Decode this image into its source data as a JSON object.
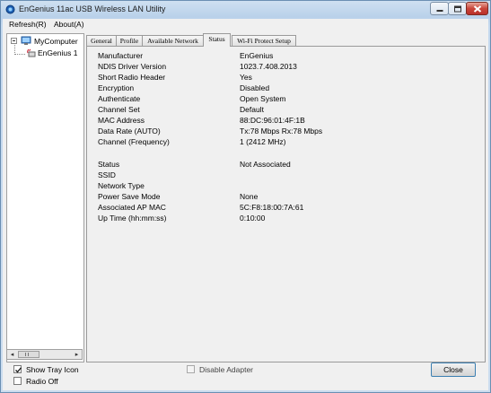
{
  "window": {
    "title": "EnGenius 11ac USB Wireless LAN Utility",
    "buttons": {
      "minimize_icon": "minimize-icon",
      "maximize_icon": "maximize-icon",
      "close_icon": "close-icon"
    }
  },
  "menu": {
    "items": [
      {
        "label": "Refresh(R)"
      },
      {
        "label": "About(A)"
      }
    ]
  },
  "tree": {
    "root_label": "MyComputer",
    "child_label": "EnGenius 1",
    "scroll_left": "◂",
    "scroll_right": "▸"
  },
  "tabs": [
    {
      "label": "General"
    },
    {
      "label": "Profile"
    },
    {
      "label": "Available Network"
    },
    {
      "label": "Status",
      "active": true
    },
    {
      "label": "Wi-Fi Protect Setup"
    }
  ],
  "status": {
    "group1": [
      {
        "label": "Manufacturer",
        "value": "EnGenius"
      },
      {
        "label": "NDIS Driver Version",
        "value": "1023.7.408.2013"
      },
      {
        "label": "Short Radio Header",
        "value": "Yes"
      },
      {
        "label": "Encryption",
        "value": "Disabled"
      },
      {
        "label": "Authenticate",
        "value": "Open System"
      },
      {
        "label": "Channel Set",
        "value": "Default"
      },
      {
        "label": "MAC Address",
        "value": "88:DC:96:01:4F:1B"
      },
      {
        "label": "Data Rate (AUTO)",
        "value": "Tx:78 Mbps Rx:78 Mbps"
      },
      {
        "label": "Channel (Frequency)",
        "value": "1 (2412 MHz)"
      }
    ],
    "group2": [
      {
        "label": "Status",
        "value": "Not Associated"
      },
      {
        "label": "SSID",
        "value": ""
      },
      {
        "label": "Network Type",
        "value": ""
      },
      {
        "label": "Power Save Mode",
        "value": "None"
      },
      {
        "label": "Associated AP MAC",
        "value": "5C:F8:18:00:7A:61"
      },
      {
        "label": "Up Time (hh:mm:ss)",
        "value": "0:10:00"
      }
    ]
  },
  "footer": {
    "show_tray_icon": {
      "label": "Show Tray Icon",
      "checked": true
    },
    "radio_off": {
      "label": "Radio Off",
      "checked": false
    },
    "disable_adapter": {
      "label": "Disable Adapter",
      "checked": false,
      "enabled": false
    },
    "close_label": "Close"
  },
  "colors": {
    "title_gradient_top": "#cfe0f1",
    "close_button_red": "#c9453a",
    "focus_border": "#3c7fb1"
  }
}
